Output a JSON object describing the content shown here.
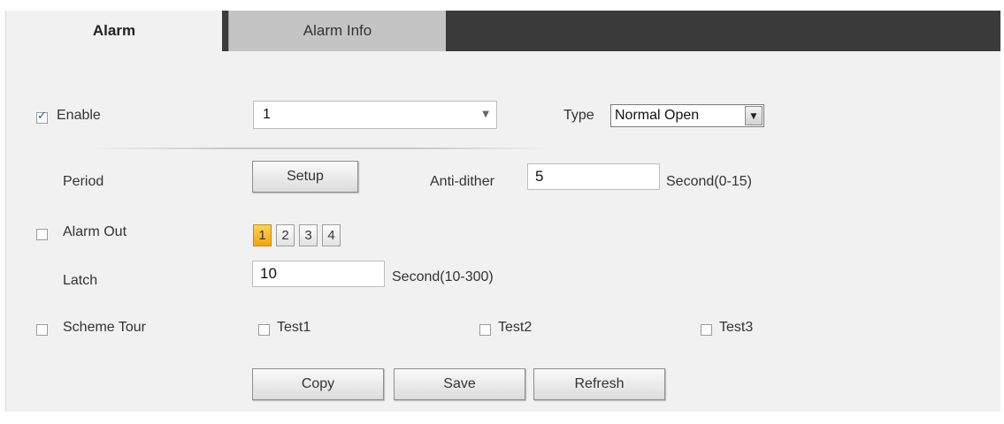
{
  "tabs": [
    {
      "label": "Alarm",
      "active": true
    },
    {
      "label": "Alarm Info",
      "active": false
    }
  ],
  "enable": {
    "label": "Enable",
    "checked": true
  },
  "channel_select": {
    "value": "1"
  },
  "type": {
    "label": "Type",
    "value": "Normal Open"
  },
  "period": {
    "label": "Period",
    "button_label": "Setup"
  },
  "anti_dither": {
    "label": "Anti-dither",
    "value": "5",
    "unit": "Second(0-15)"
  },
  "alarm_out": {
    "label": "Alarm Out",
    "checked": false,
    "channels": [
      "1",
      "2",
      "3",
      "4"
    ],
    "selected": "1"
  },
  "latch": {
    "label": "Latch",
    "value": "10",
    "unit": "Second(10-300)"
  },
  "scheme_tour": {
    "label": "Scheme Tour",
    "checked": false,
    "options": [
      {
        "label": "Test1",
        "checked": false
      },
      {
        "label": "Test2",
        "checked": false
      },
      {
        "label": "Test3",
        "checked": false
      }
    ]
  },
  "actions": {
    "copy": "Copy",
    "save": "Save",
    "refresh": "Refresh"
  },
  "colors": {
    "accent_active": "#f2a20f",
    "tabbar_bg": "#3a3a3a",
    "panel_bg": "#f1f1f1",
    "check_color": "#1f57b8"
  },
  "icons": {
    "dropdown": "chevron-down-icon",
    "checkbox_checked": "check-icon"
  }
}
